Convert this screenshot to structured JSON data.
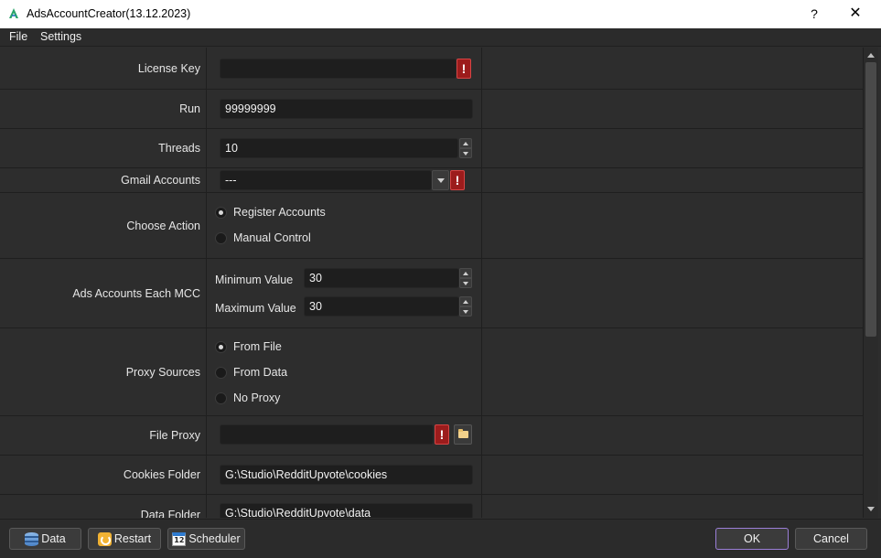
{
  "window": {
    "title": "AdsAccountCreator(13.12.2023)",
    "help_glyph": "?",
    "close_glyph": "✕"
  },
  "menu": [
    "File",
    "Settings"
  ],
  "form": {
    "license_key": {
      "label": "License Key",
      "value": "",
      "warning": "!"
    },
    "run": {
      "label": "Run",
      "value": "99999999"
    },
    "threads": {
      "label": "Threads",
      "value": "10"
    },
    "gmail_accounts": {
      "label": "Gmail Accounts",
      "value": "---",
      "warning": "!"
    },
    "choose_action": {
      "label": "Choose Action",
      "options": [
        "Register Accounts",
        "Manual Control"
      ],
      "selected": "Register Accounts"
    },
    "ads_accounts_each_mcc": {
      "label": "Ads Accounts Each MCC",
      "min_label": "Minimum Value",
      "min_value": "30",
      "max_label": "Maximum Value",
      "max_value": "30"
    },
    "proxy_sources": {
      "label": "Proxy Sources",
      "options": [
        "From File",
        "From Data",
        "No Proxy"
      ],
      "selected": "From File"
    },
    "file_proxy": {
      "label": "File Proxy",
      "value": "",
      "warning": "!"
    },
    "cookies_folder": {
      "label": "Cookies Folder",
      "value": "G:\\Studio\\RedditUpvote\\cookies"
    },
    "data_folder": {
      "label": "Data Folder",
      "value": "G:\\Studio\\RedditUpvote\\data"
    }
  },
  "bottom": {
    "data_label": "Data",
    "restart_label": "Restart",
    "scheduler_label": "Scheduler",
    "scheduler_icon_text": "12",
    "ok_label": "OK",
    "cancel_label": "Cancel"
  },
  "colors": {
    "background": "#2d2d2d",
    "field": "#1e1e1e",
    "warning": "#9c1c1c",
    "ok_border": "#9b7fd8"
  }
}
